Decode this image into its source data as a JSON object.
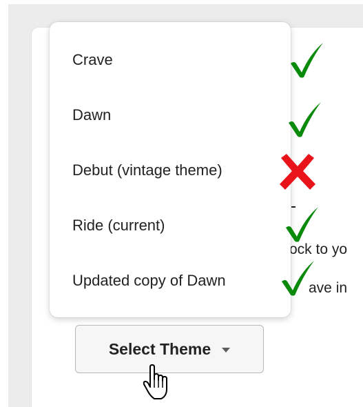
{
  "theme_menu": {
    "items": [
      {
        "label": "Crave",
        "mark": "green-checkmark-icon",
        "mark_color": "#008000"
      },
      {
        "label": "Dawn",
        "mark": "green-checkmark-icon",
        "mark_color": "#008000"
      },
      {
        "label": "Debut (vintage theme)",
        "mark": "red-x-icon",
        "mark_color": "#ff0000"
      },
      {
        "label": "Ride (current)",
        "mark": "green-checkmark-icon",
        "mark_color": "#008000"
      },
      {
        "label": "Updated copy of Dawn",
        "mark": "green-checkmark-icon",
        "mark_color": "#008000"
      }
    ]
  },
  "select_button": {
    "label": "Select Theme",
    "icon": "caret-down-icon"
  },
  "background_text": {
    "line1": "ock to yo",
    "line2": "ave in"
  },
  "cursor": {
    "icon": "hand-pointer-icon"
  }
}
